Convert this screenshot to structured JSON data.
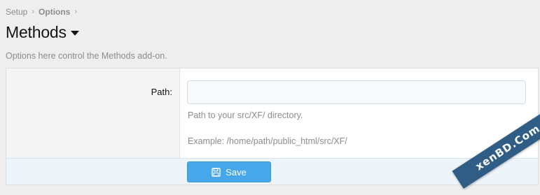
{
  "breadcrumb": {
    "items": [
      "Setup",
      "Options"
    ],
    "separator": "›"
  },
  "header": {
    "title": "Methods",
    "description": "Options here control the Methods add-on."
  },
  "form": {
    "path_label": "Path:",
    "path_value": "",
    "path_placeholder": "",
    "hint_line1": "Path to your src/XF/ directory.",
    "hint_line2": "Example: /home/path/public_html/src/XF/",
    "save_label": "Save"
  },
  "watermark": {
    "text": "xenBD.Com"
  },
  "colors": {
    "accent": "#47a7eb",
    "submit_row_bg": "#edf4fa",
    "page_bg": "#eeeeee",
    "watermark_bg": "#2f5d86"
  },
  "icons": {
    "title_dropdown": "caret-down-icon",
    "save": "floppy-disk-icon"
  }
}
